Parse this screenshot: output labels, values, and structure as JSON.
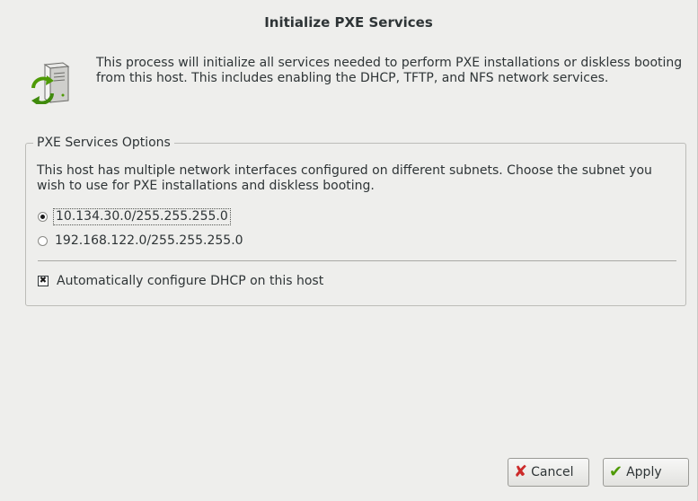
{
  "window": {
    "title": "Initialize PXE Services"
  },
  "intro": {
    "icon": "server-sync-icon",
    "text": "This process will initialize all services needed to perform PXE installations or diskless booting from this host.  This includes enabling the DHCP, TFTP, and NFS network services."
  },
  "options_frame": {
    "legend": "PXE Services Options",
    "description": "This host has multiple network interfaces configured on different subnets.  Choose the subnet you wish to use for PXE installations and diskless booting.",
    "subnets": [
      {
        "label": "10.134.30.0/255.255.255.0",
        "selected": true
      },
      {
        "label": "192.168.122.0/255.255.255.0",
        "selected": false
      }
    ],
    "dhcp_checkbox": {
      "label": "Automatically configure DHCP on this host",
      "checked": true
    }
  },
  "buttons": {
    "cancel": {
      "label": "Cancel",
      "icon": "cancel-x-icon",
      "color": "#cc2a2a"
    },
    "apply": {
      "label": "Apply",
      "icon": "checkmark-icon",
      "color": "#4e9a06"
    }
  }
}
